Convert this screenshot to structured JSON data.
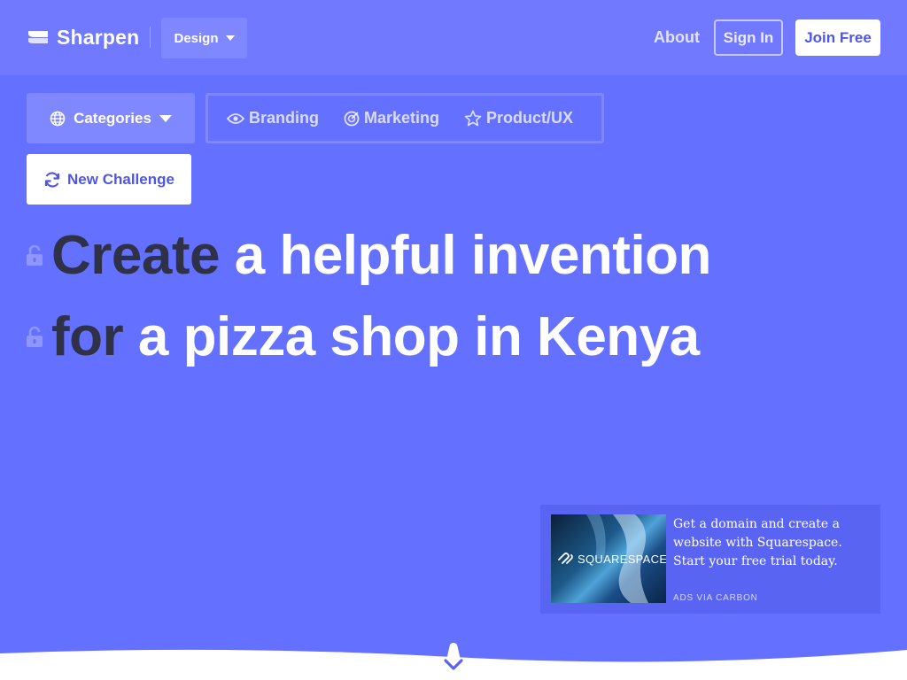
{
  "header": {
    "brand": "Sharpen",
    "design_label": "Design",
    "nav": {
      "about": "About",
      "sign_in": "Sign In",
      "join_free": "Join Free"
    }
  },
  "filters": {
    "categories_label": "Categories",
    "items": [
      {
        "label": "Branding",
        "icon": "eye-icon"
      },
      {
        "label": "Marketing",
        "icon": "target-icon"
      },
      {
        "label": "Product/UX",
        "icon": "star-icon"
      }
    ],
    "new_challenge_label": "New Challenge"
  },
  "prompt": {
    "line1": {
      "keyword": "Create",
      "rest": "a helpful invention"
    },
    "line2": {
      "keyword": "for",
      "rest": "a pizza shop in Kenya"
    }
  },
  "ad": {
    "image_brand": "SQUARESPACE",
    "text": "Get a domain and create a website with Squarespace. Start your free trial today.",
    "via": "ADS VIA CARBON"
  },
  "colors": {
    "background": "#6470ff",
    "header": "#7079ff",
    "accent_dark": "#2f3147",
    "button_text": "#4d56e8"
  }
}
